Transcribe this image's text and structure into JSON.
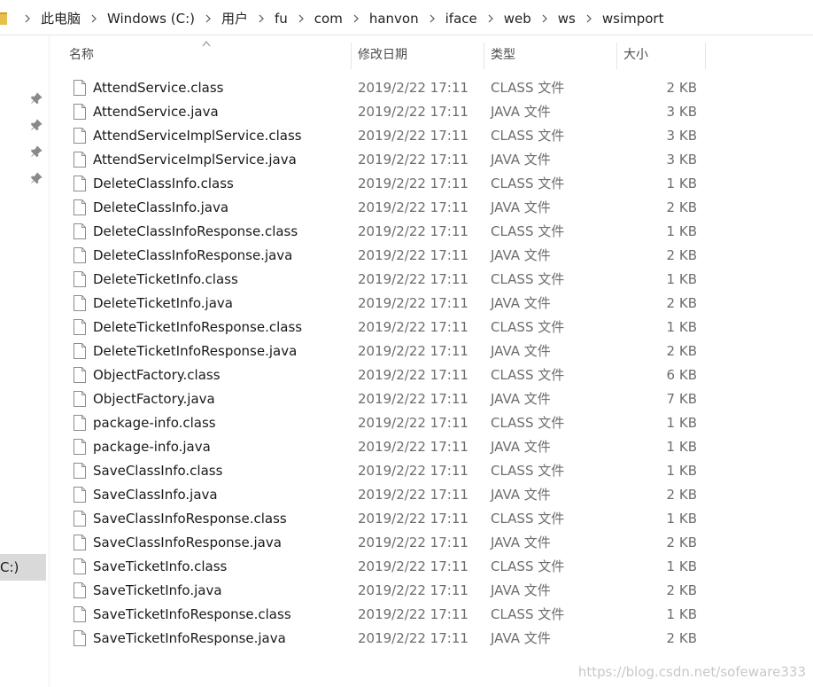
{
  "breadcrumb": [
    "此电脑",
    "Windows (C:)",
    "用户",
    "fu",
    "com",
    "hanvon",
    "iface",
    "web",
    "ws",
    "wsimport"
  ],
  "nav": {
    "drive_label": "C:)"
  },
  "columns": {
    "name": "名称",
    "date": "修改日期",
    "type": "类型",
    "size": "大小"
  },
  "files": [
    {
      "name": "AttendService.class",
      "date": "2019/2/22 17:11",
      "type": "CLASS 文件",
      "size": "2 KB"
    },
    {
      "name": "AttendService.java",
      "date": "2019/2/22 17:11",
      "type": "JAVA 文件",
      "size": "3 KB"
    },
    {
      "name": "AttendServiceImplService.class",
      "date": "2019/2/22 17:11",
      "type": "CLASS 文件",
      "size": "3 KB"
    },
    {
      "name": "AttendServiceImplService.java",
      "date": "2019/2/22 17:11",
      "type": "JAVA 文件",
      "size": "3 KB"
    },
    {
      "name": "DeleteClassInfo.class",
      "date": "2019/2/22 17:11",
      "type": "CLASS 文件",
      "size": "1 KB"
    },
    {
      "name": "DeleteClassInfo.java",
      "date": "2019/2/22 17:11",
      "type": "JAVA 文件",
      "size": "2 KB"
    },
    {
      "name": "DeleteClassInfoResponse.class",
      "date": "2019/2/22 17:11",
      "type": "CLASS 文件",
      "size": "1 KB"
    },
    {
      "name": "DeleteClassInfoResponse.java",
      "date": "2019/2/22 17:11",
      "type": "JAVA 文件",
      "size": "2 KB"
    },
    {
      "name": "DeleteTicketInfo.class",
      "date": "2019/2/22 17:11",
      "type": "CLASS 文件",
      "size": "1 KB"
    },
    {
      "name": "DeleteTicketInfo.java",
      "date": "2019/2/22 17:11",
      "type": "JAVA 文件",
      "size": "2 KB"
    },
    {
      "name": "DeleteTicketInfoResponse.class",
      "date": "2019/2/22 17:11",
      "type": "CLASS 文件",
      "size": "1 KB"
    },
    {
      "name": "DeleteTicketInfoResponse.java",
      "date": "2019/2/22 17:11",
      "type": "JAVA 文件",
      "size": "2 KB"
    },
    {
      "name": "ObjectFactory.class",
      "date": "2019/2/22 17:11",
      "type": "CLASS 文件",
      "size": "6 KB"
    },
    {
      "name": "ObjectFactory.java",
      "date": "2019/2/22 17:11",
      "type": "JAVA 文件",
      "size": "7 KB"
    },
    {
      "name": "package-info.class",
      "date": "2019/2/22 17:11",
      "type": "CLASS 文件",
      "size": "1 KB"
    },
    {
      "name": "package-info.java",
      "date": "2019/2/22 17:11",
      "type": "JAVA 文件",
      "size": "1 KB"
    },
    {
      "name": "SaveClassInfo.class",
      "date": "2019/2/22 17:11",
      "type": "CLASS 文件",
      "size": "1 KB"
    },
    {
      "name": "SaveClassInfo.java",
      "date": "2019/2/22 17:11",
      "type": "JAVA 文件",
      "size": "2 KB"
    },
    {
      "name": "SaveClassInfoResponse.class",
      "date": "2019/2/22 17:11",
      "type": "CLASS 文件",
      "size": "1 KB"
    },
    {
      "name": "SaveClassInfoResponse.java",
      "date": "2019/2/22 17:11",
      "type": "JAVA 文件",
      "size": "2 KB"
    },
    {
      "name": "SaveTicketInfo.class",
      "date": "2019/2/22 17:11",
      "type": "CLASS 文件",
      "size": "1 KB"
    },
    {
      "name": "SaveTicketInfo.java",
      "date": "2019/2/22 17:11",
      "type": "JAVA 文件",
      "size": "2 KB"
    },
    {
      "name": "SaveTicketInfoResponse.class",
      "date": "2019/2/22 17:11",
      "type": "CLASS 文件",
      "size": "1 KB"
    },
    {
      "name": "SaveTicketInfoResponse.java",
      "date": "2019/2/22 17:11",
      "type": "JAVA 文件",
      "size": "2 KB"
    }
  ],
  "watermark": "https://blog.csdn.net/sofeware333"
}
